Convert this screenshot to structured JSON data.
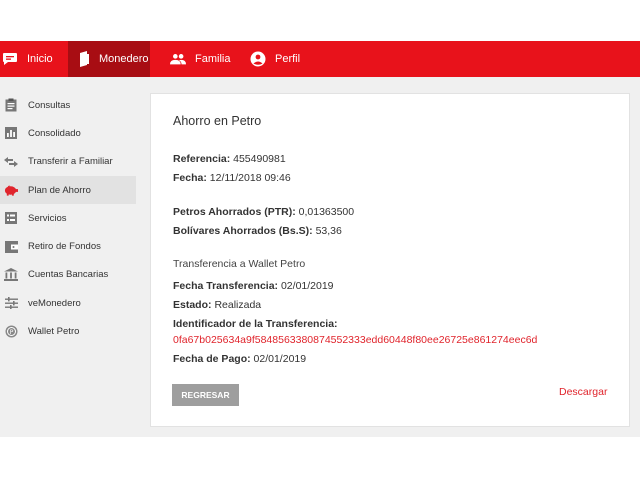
{
  "nav": {
    "inicio": "Inicio",
    "monedero": "Monedero",
    "familia": "Familia",
    "perfil": "Perfil"
  },
  "sidebar": {
    "items": [
      {
        "label": "Consultas",
        "icon": "clipboard-icon"
      },
      {
        "label": "Consolidado",
        "icon": "bar-chart-icon"
      },
      {
        "label": "Transferir a Familiar",
        "icon": "swap-arrows-icon"
      },
      {
        "label": "Plan de Ahorro",
        "icon": "piggy-bank-icon"
      },
      {
        "label": "Servicios",
        "icon": "list-icon"
      },
      {
        "label": "Retiro de Fondos",
        "icon": "wallet-icon"
      },
      {
        "label": "Cuentas Bancarias",
        "icon": "bank-icon"
      },
      {
        "label": "veMonedero",
        "icon": "sliders-icon"
      },
      {
        "label": "Wallet Petro",
        "icon": "petro-coin-icon"
      }
    ]
  },
  "card": {
    "title": "Ahorro en Petro",
    "referencia_label": "Referencia:",
    "referencia_value": "455490981",
    "fecha_label": "Fecha:",
    "fecha_value": "12/11/2018 09:46",
    "petros_label": "Petros Ahorrados (PTR):",
    "petros_value": "0,01363500",
    "bolivares_label": "Bolívares Ahorrados (Bs.S):",
    "bolivares_value": "53,36",
    "transfer_title": "Transferencia a Wallet Petro",
    "fecha_transf_label": "Fecha Transferencia:",
    "fecha_transf_value": "02/01/2019",
    "estado_label": "Estado:",
    "estado_value": "Realizada",
    "identificador_label": "Identificador de la Transferencia:",
    "identificador_value": "0fa67b025634a9f5848563380874552333edd60448f80ee26725e861274eec6d",
    "fecha_pago_label": "Fecha de Pago:",
    "fecha_pago_value": "02/01/2019",
    "regresar": "REGRESAR",
    "descargar": "Descargar"
  },
  "colors": {
    "brand_red": "#e8121b",
    "active_red": "#a80d13",
    "link_red": "#e0242c",
    "button_gray": "#9e9e9e"
  }
}
